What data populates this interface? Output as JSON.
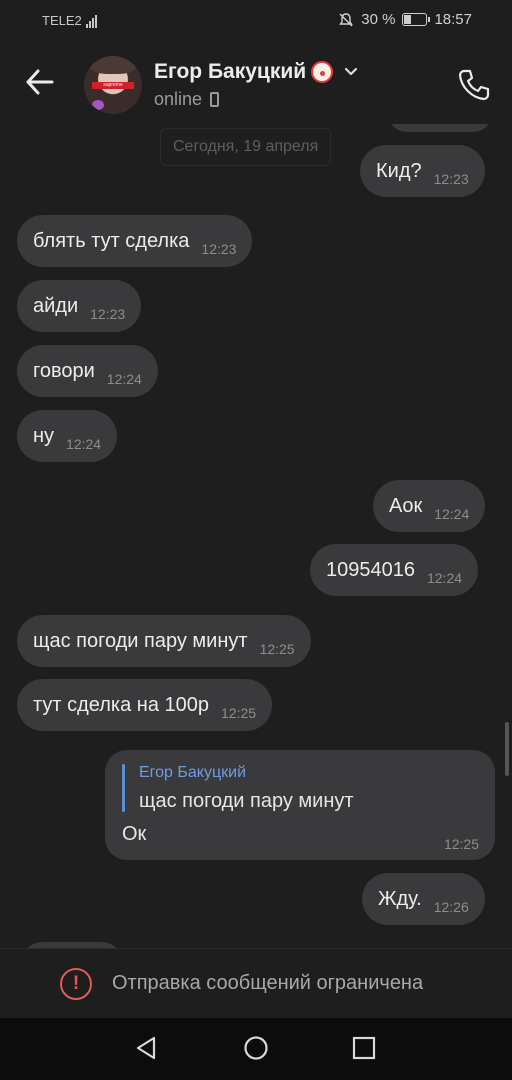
{
  "status_bar": {
    "carrier": "TELE2",
    "battery_percent": "30 %",
    "battery_level": 0.3,
    "time": "18:57",
    "icons": [
      "signal-icon",
      "mute-icon",
      "battery-icon"
    ]
  },
  "header": {
    "contact_name": "Егор Бакуцкий",
    "name_emoji": "clown-face-icon",
    "presence": "online",
    "presence_device": "mobile-phone-icon",
    "avatar_band_text": "supreme"
  },
  "chat": {
    "date_separator": "Сегодня, 19 апреля",
    "messages": [
      {
        "direction": "out",
        "text": "Кид?",
        "time": "12:23"
      },
      {
        "direction": "in",
        "text": "блять тут сделка",
        "time": "12:23"
      },
      {
        "direction": "in",
        "text": "айди",
        "time": "12:23"
      },
      {
        "direction": "in",
        "text": "говори",
        "time": "12:24"
      },
      {
        "direction": "in",
        "text": "ну",
        "time": "12:24"
      },
      {
        "direction": "out",
        "text": "Аок",
        "time": "12:24"
      },
      {
        "direction": "out",
        "text": "10954016",
        "time": "12:24"
      },
      {
        "direction": "in",
        "text": "щас погоди пару минут",
        "time": "12:25"
      },
      {
        "direction": "in",
        "text": "тут сделка на 100р",
        "time": "12:25"
      },
      {
        "direction": "out",
        "text": "Ок",
        "time": "12:25",
        "reply_to": {
          "author": "Егор Бакуцкий",
          "text": "щас погоди пару минут"
        }
      },
      {
        "direction": "out",
        "text": "Жду.",
        "time": "12:26"
      }
    ]
  },
  "composer": {
    "restriction_text": "Отправка сообщений ограничена"
  },
  "colors": {
    "background": "#1e1e1e",
    "bubble": "#3a3a3c",
    "accent_link": "#6d9de0",
    "warning": "#e05a5a"
  }
}
